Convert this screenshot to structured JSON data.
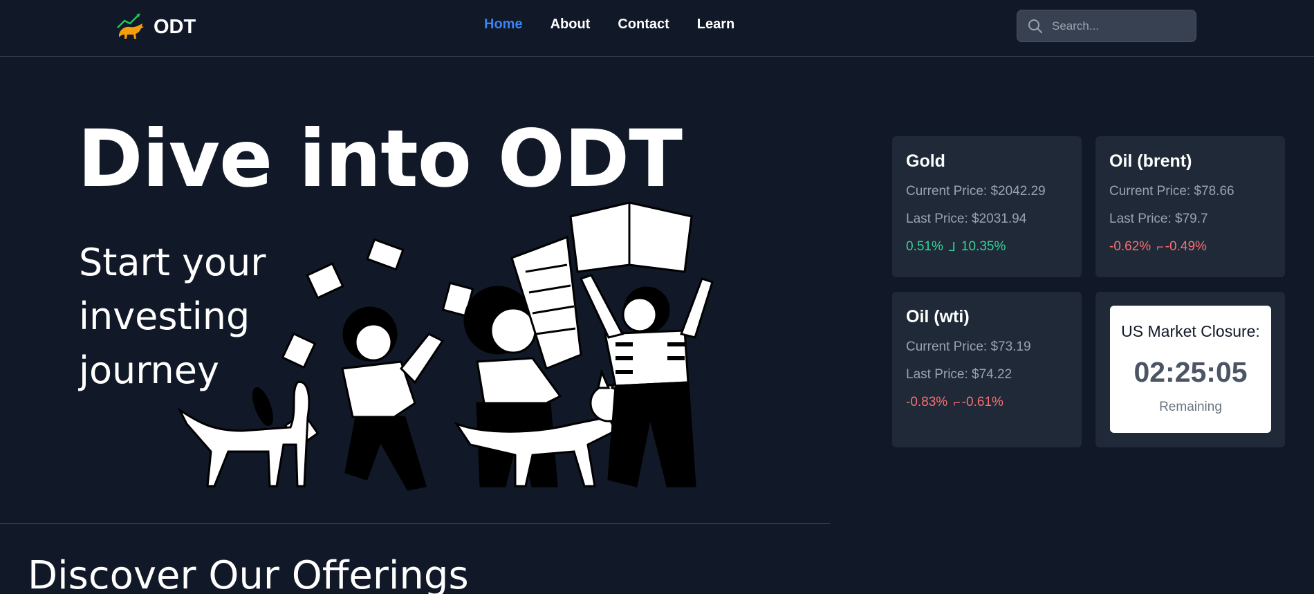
{
  "brand": {
    "name": "ODT"
  },
  "nav": {
    "home": "Home",
    "about": "About",
    "contact": "Contact",
    "learn": "Learn"
  },
  "search": {
    "placeholder": "Search..."
  },
  "hero": {
    "title": "Dive into ODT",
    "subtitle_line1": "Start your",
    "subtitle_line2": "investing",
    "subtitle_line3": "journey"
  },
  "commodities": [
    {
      "name": "Gold",
      "current": "Current Price: $2042.29",
      "last": "Last Price: $2031.94",
      "change1": "0.51%",
      "change2": "10.35%",
      "trend": "up"
    },
    {
      "name": "Oil (brent)",
      "current": "Current Price: $78.66",
      "last": "Last Price: $79.7",
      "change1": "-0.62%",
      "change2": "-0.49%",
      "trend": "down"
    },
    {
      "name": "Oil (wti)",
      "current": "Current Price: $73.19",
      "last": "Last Price: $74.22",
      "change1": "-0.83%",
      "change2": "-0.61%",
      "trend": "down"
    }
  ],
  "market_closure": {
    "title": "US Market Closure:",
    "time": "02:25:05",
    "remaining": "Remaining"
  },
  "offerings": {
    "title": "Discover Our Offerings"
  },
  "colors": {
    "background": "#111827",
    "card": "#1f2937",
    "accent": "#3b82f6",
    "up": "#34d399",
    "down": "#f87171"
  }
}
